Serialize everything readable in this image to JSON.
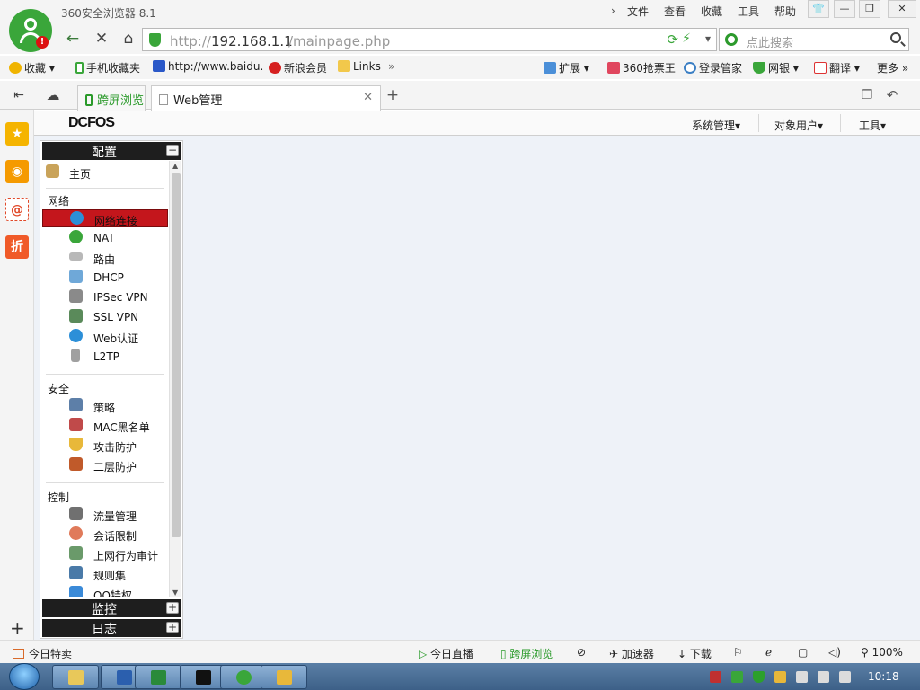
{
  "browser": {
    "title": "360安全浏览器 8.1",
    "menu": [
      "文件",
      "查看",
      "收藏",
      "工具",
      "帮助"
    ],
    "url": {
      "protocol": "http://",
      "host": "192.168.1.1",
      "path": "/mainpage.php"
    },
    "search_placeholder": "点此搜索",
    "bookmarks": [
      "收藏",
      "手机收藏夹",
      "http://www.baidu.",
      "新浪会员",
      "Links"
    ],
    "bookmarks_right": [
      "扩展",
      "360抢票王",
      "登录管家",
      "网银",
      "翻译",
      "更多"
    ],
    "tabs": [
      {
        "label": "跨屏浏览"
      },
      {
        "label": "Web管理"
      }
    ]
  },
  "side_icons": [
    "star-icon",
    "weibo-icon",
    "mail-icon",
    "discount-icon"
  ],
  "side_discount_label": "折",
  "page": {
    "logo": "DCFOS",
    "top_menu": [
      "系统管理▾",
      "对象用户▾",
      "工具▾"
    ],
    "panels": {
      "config": "配置",
      "monitor": "监控",
      "log": "日志"
    },
    "home": "主页",
    "groups": [
      {
        "name": "网络",
        "items": [
          "网络连接",
          "NAT",
          "路由",
          "DHCP",
          "IPSec VPN",
          "SSL VPN",
          "Web认证",
          "L2TP"
        ]
      },
      {
        "name": "安全",
        "items": [
          "策略",
          "MAC黑名单",
          "攻击防护",
          "二层防护"
        ]
      },
      {
        "name": "控制",
        "items": [
          "流量管理",
          "会话限制",
          "上网行为审计",
          "规则集",
          "QQ特权"
        ]
      }
    ],
    "active_item": "网络连接"
  },
  "status": {
    "left": "今日特卖",
    "items": [
      "今日直播",
      "跨屏浏览",
      "加速器",
      "下载"
    ],
    "zoom": "100%"
  },
  "taskbar": {
    "clock": "10:18"
  },
  "colors": {
    "brand_green": "#3aa63a",
    "active_red": "#c4161c",
    "panel_dark": "#1e1e1e"
  }
}
